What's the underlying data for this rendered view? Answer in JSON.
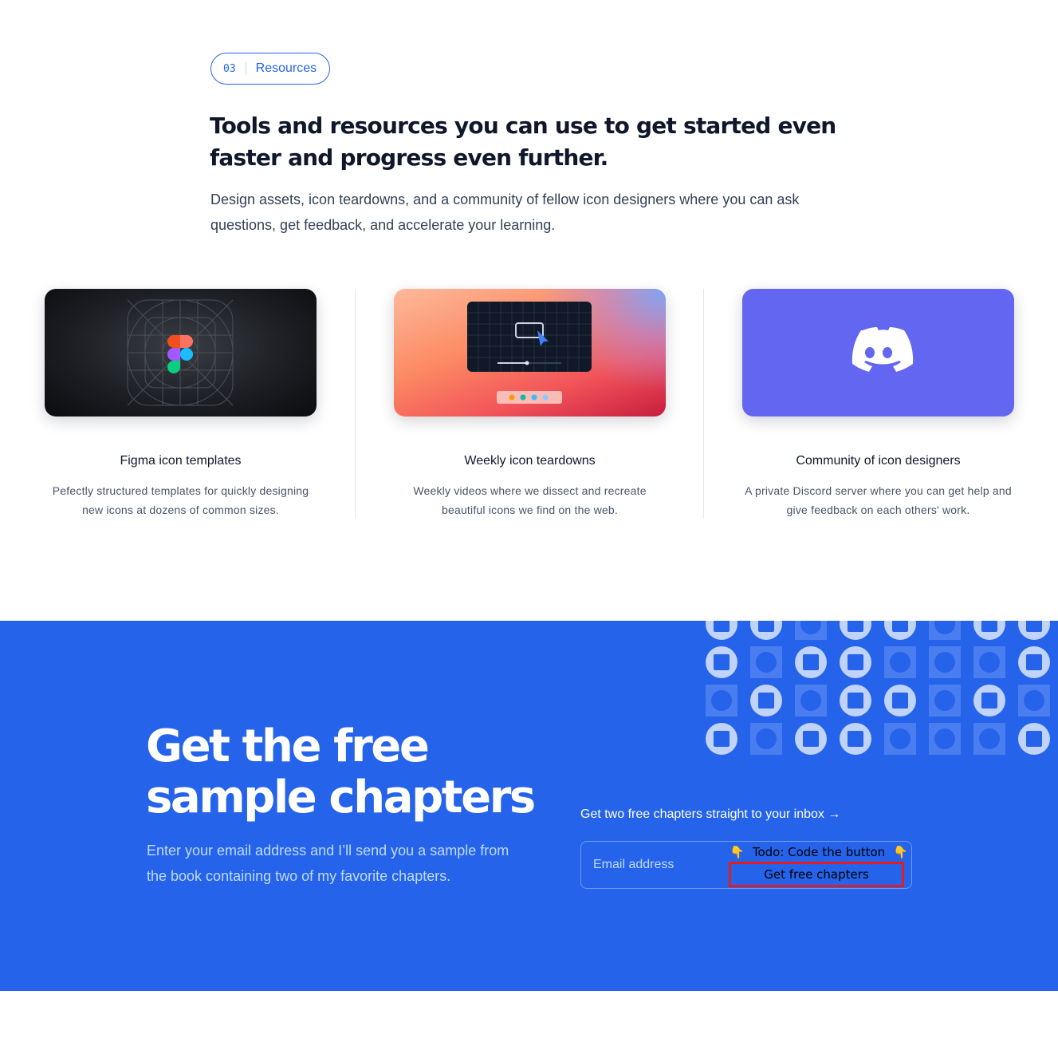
{
  "section_badge": {
    "number": "03",
    "label": "Resources"
  },
  "headline": "Tools and resources you can use to get started even faster and progress even further.",
  "lede": "Design assets, icon teardowns, and a community of fellow icon designers where you can ask questions, get feedback, and accelerate your learning.",
  "cards": [
    {
      "title": "Figma icon templates",
      "description": "Pefectly structured templates for quickly designing new icons at dozens of common sizes.",
      "image_icon": "figma-logo-icon"
    },
    {
      "title": "Weekly icon teardowns",
      "description": "Weekly videos where we dissect and recreate beautiful icons we find on the web.",
      "image_icon": "video-player-icon"
    },
    {
      "title": "Community of icon designers",
      "description": "A private Discord server where you can get help and give feedback on each others' work.",
      "image_icon": "discord-icon"
    }
  ],
  "cta": {
    "title": "Get the free sample chapters",
    "subtitle": "Enter your email address and I’ll send you a sample from the book containing two of my favorite chapters.",
    "link": "Get two free chapters straight to your inbox →",
    "email_placeholder": "Email address",
    "todo_note": "Todo: Code the button",
    "hand_glyph": "👇",
    "button_label": "Get free chapters"
  },
  "colors": {
    "brand_blue": "#2563eb",
    "discord_purple": "#6366f1",
    "highlight_red": "#e11d1d"
  }
}
